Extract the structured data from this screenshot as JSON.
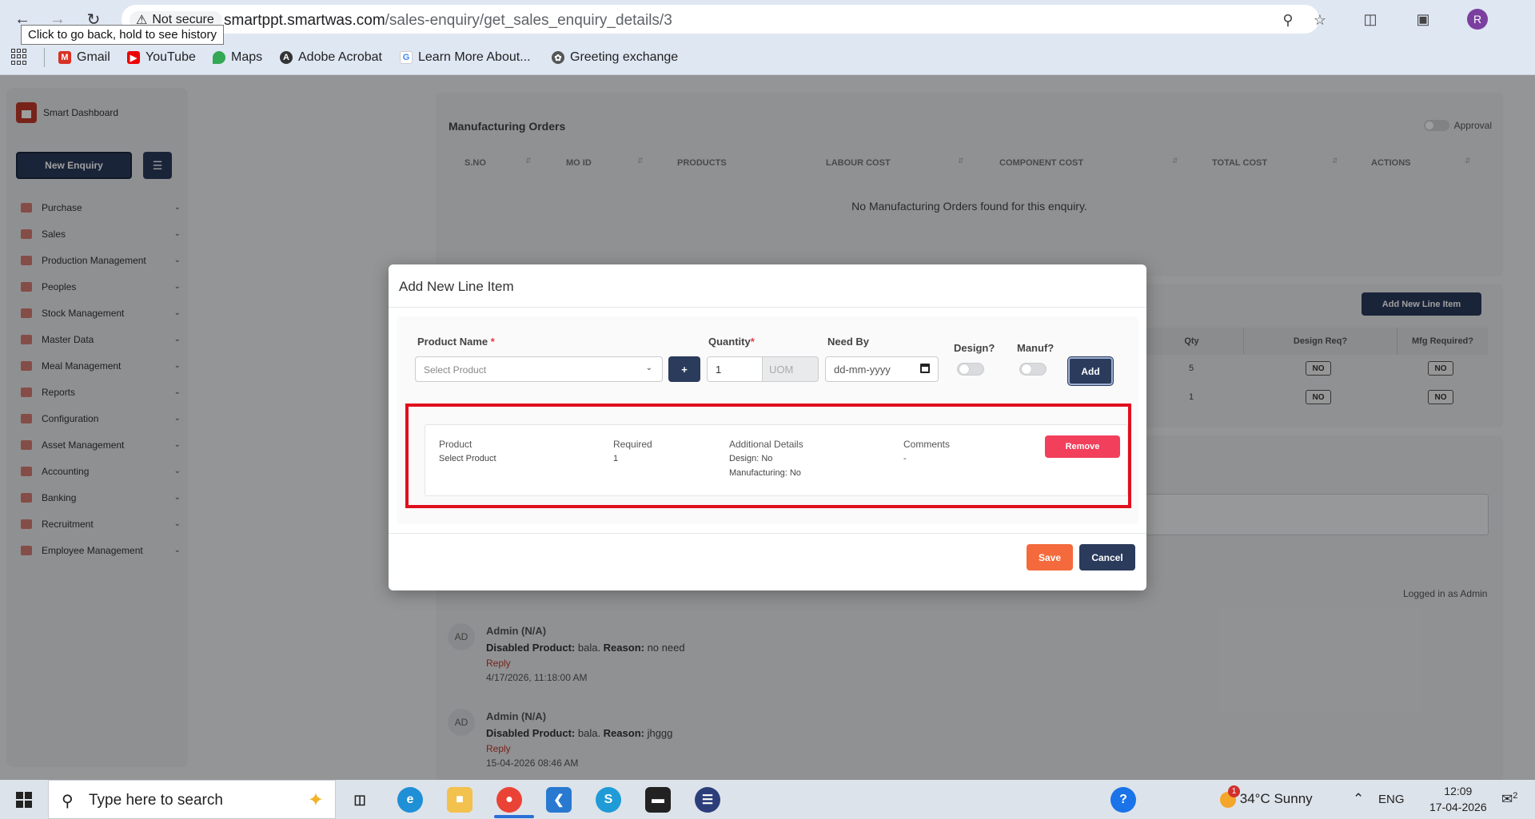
{
  "browser": {
    "security_label": "Not secure",
    "url_host": "smartppt.smartwas.com",
    "url_path": "/sales-enquiry/get_sales_enquiry_details/3",
    "tooltip": "Click to go back, hold to see history",
    "profile_initial": "R",
    "bookmarks": [
      {
        "label": "Gmail",
        "icon": "gmail-icon"
      },
      {
        "label": "YouTube",
        "icon": "youtube-icon"
      },
      {
        "label": "Maps",
        "icon": "maps-icon"
      },
      {
        "label": "Adobe Acrobat",
        "icon": "acrobat-icon"
      },
      {
        "label": "Learn More About...",
        "icon": "google-icon"
      },
      {
        "label": "Greeting exchange",
        "icon": "greeting-icon"
      }
    ]
  },
  "sidebar": {
    "brand": "Smart Dashboard",
    "new_enquiry": "New Enquiry",
    "items": [
      "Purchase",
      "Sales",
      "Production Management",
      "Peoples",
      "Stock Management",
      "Master Data",
      "Meal Management",
      "Reports",
      "Configuration",
      "Asset Management",
      "Accounting",
      "Banking",
      "Recruitment",
      "Employee Management"
    ]
  },
  "manufacturing": {
    "title": "Manufacturing Orders",
    "approval_label": "Approval",
    "columns": [
      "S.NO",
      "MO ID",
      "PRODUCTS",
      "LABOUR COST",
      "COMPONENT COST",
      "TOTAL COST",
      "ACTIONS"
    ],
    "empty_text": "No Manufacturing Orders found for this enquiry."
  },
  "line_items": {
    "add_button": "Add New Line Item",
    "columns": [
      "Qty",
      "Design Req?",
      "Mfg Required?"
    ],
    "rows": [
      {
        "qty": "5",
        "design": "NO",
        "mfg": "NO"
      },
      {
        "qty": "1",
        "design": "NO",
        "mfg": "NO"
      }
    ]
  },
  "comments": {
    "logged_in": "Logged in as Admin",
    "entries": [
      {
        "initials": "AD",
        "author": "Admin (N/A)",
        "label": "Disabled Product:",
        "product": " bala. ",
        "reason_label": "Reason:",
        "reason": " no need",
        "reply": "Reply",
        "time": "4/17/2026, 11:18:00 AM"
      },
      {
        "initials": "AD",
        "author": "Admin (N/A)",
        "label": "Disabled Product:",
        "product": " bala. ",
        "reason_label": "Reason:",
        "reason": " jhggg",
        "reply": "Reply",
        "time": "15-04-2026 08:46 AM"
      }
    ]
  },
  "modal": {
    "title": "Add New Line Item",
    "product_label": "Product Name",
    "required_mark": "*",
    "product_placeholder": "Select Product",
    "plus_label": "+",
    "quantity_label": "Quantity",
    "quantity_value": "1",
    "uom_placeholder": "UOM",
    "need_by_label": "Need By",
    "date_placeholder": "dd-mm-yyyy",
    "design_label": "Design?",
    "manuf_label": "Manuf?",
    "add_label": "Add",
    "item": {
      "product_h": "Product",
      "product_v": "Select Product",
      "required_h": "Required",
      "required_v": "1",
      "details_h": "Additional Details",
      "design_v": "Design: No",
      "manuf_v": "Manufacturing: No",
      "comments_h": "Comments",
      "comments_v": "-"
    },
    "remove_label": "Remove",
    "save_label": "Save",
    "cancel_label": "Cancel"
  },
  "taskbar": {
    "search_placeholder": "Type here to search",
    "weather_badge": "1",
    "weather": "34°C  Sunny",
    "language": "ENG",
    "time": "12:09",
    "date": "17-04-2026",
    "notification_count": "2"
  },
  "colors": {
    "primary": "#2b3b5c",
    "danger": "#f23f5b",
    "save": "#f46a3c",
    "highlight": "#e0101d"
  }
}
